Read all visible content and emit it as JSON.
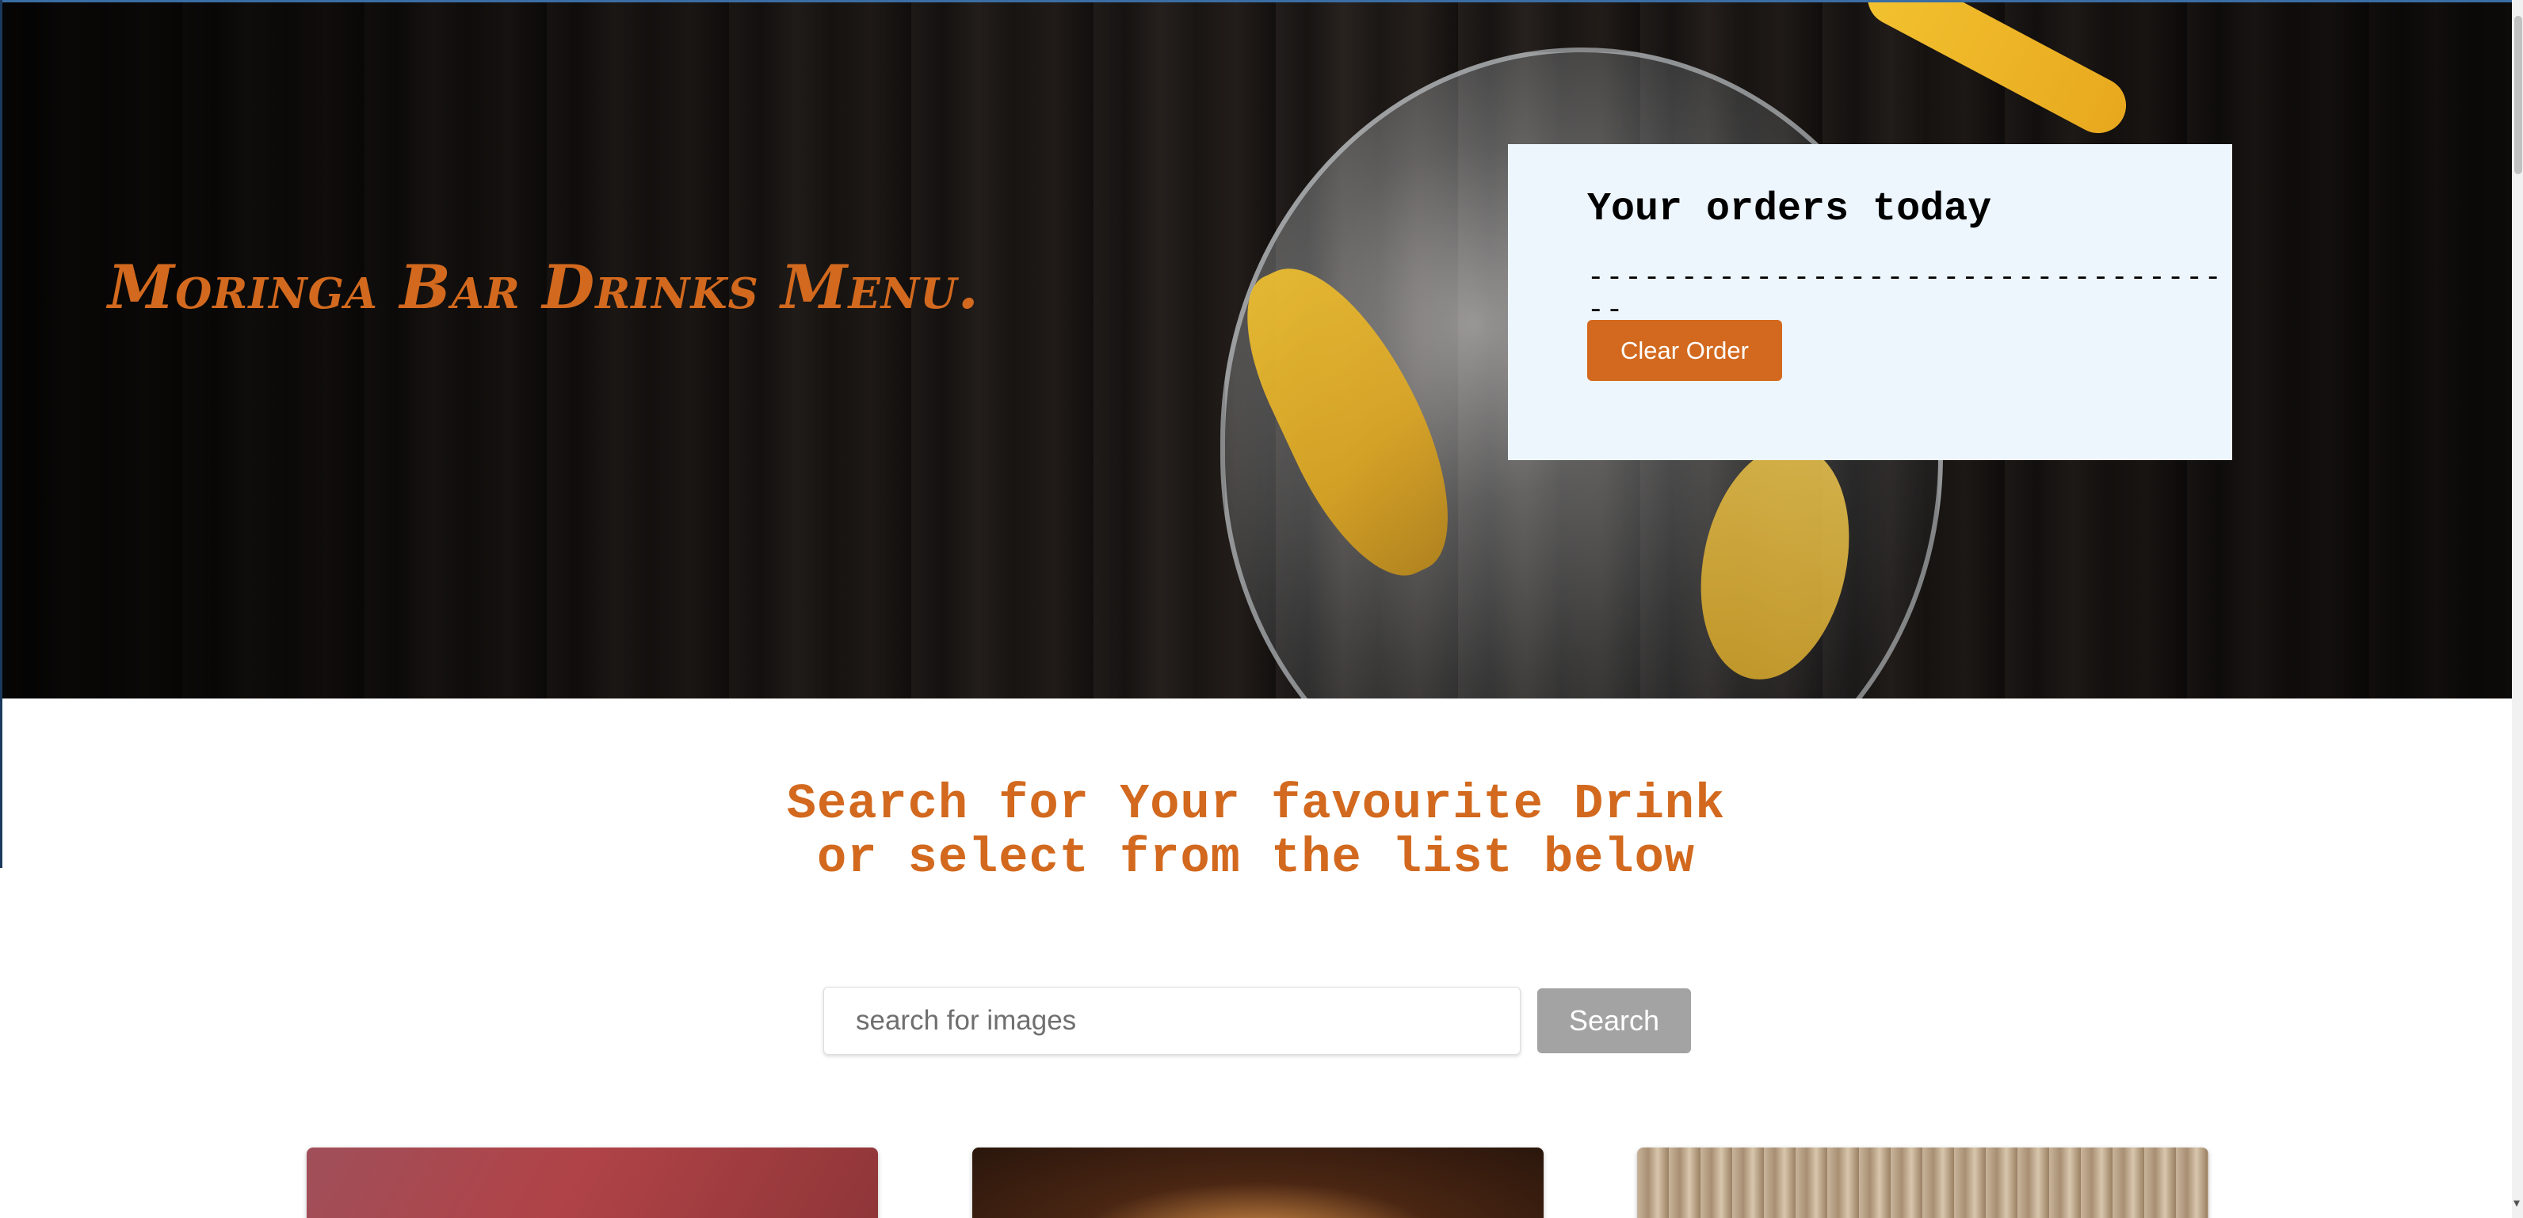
{
  "hero": {
    "title": "Moringa Bar Drinks Menu."
  },
  "orders": {
    "title": "Your orders today",
    "divider": "------------------------------------",
    "clear_label": "Clear Order"
  },
  "search": {
    "heading_line1": "Search for Your favourite Drink",
    "heading_line2": "or select from the list below",
    "placeholder": "search for images",
    "value": "",
    "button_label": "Search"
  },
  "cards": [
    {
      "image": "red-drink-image"
    },
    {
      "image": "rimmed-cocktail-image"
    },
    {
      "image": "wood-background-image"
    }
  ],
  "colors": {
    "accent": "#d2691e",
    "card_bg": "#eef6fd",
    "search_button": "#a3a3a3"
  },
  "icons": {
    "scroll_down": "chevron-down-icon"
  }
}
